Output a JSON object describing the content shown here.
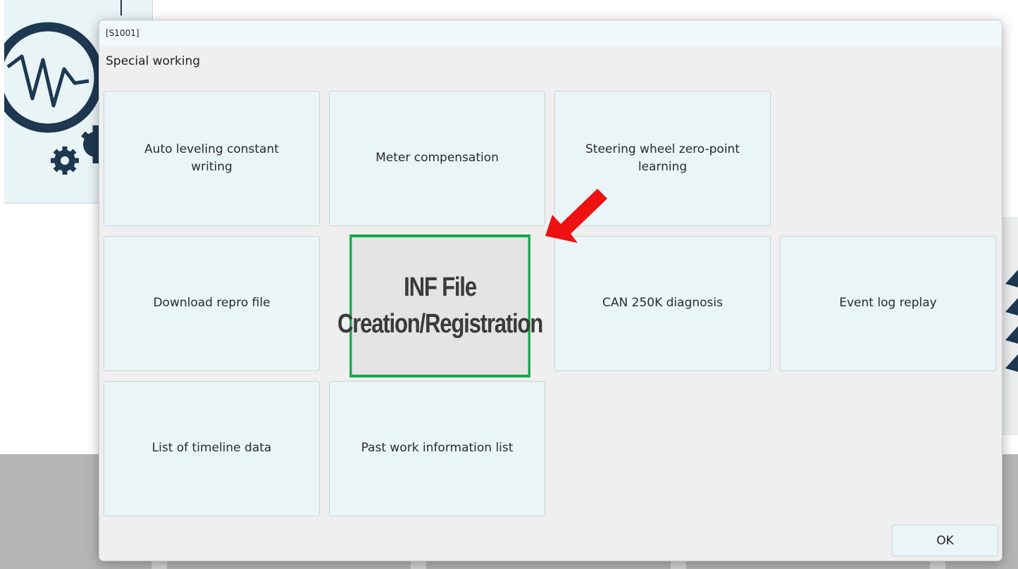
{
  "dialog": {
    "screen_id": "[S1001]",
    "title": "Special working",
    "ok_label": "OK"
  },
  "tiles": [
    {
      "label": "Auto leveling constant writing"
    },
    {
      "label": "Meter compensation"
    },
    {
      "label": "Steering wheel zero-point learning"
    },
    {
      "label": "Download repro file"
    },
    {
      "label": "INF File Creation/Registration"
    },
    {
      "label": "CAN 250K diagnosis"
    },
    {
      "label": "Event log replay"
    },
    {
      "label": "List of timeline data"
    },
    {
      "label": "Past work information list"
    }
  ],
  "annotation": {
    "arrow_color": "#ee1111",
    "highlight_color": "#13a84a",
    "arrow_icon": "red-arrow-icon"
  },
  "colors": {
    "tile_bg": "#eaf5f8",
    "dialog_bg": "#efefef",
    "logo_navy": "#1d3850"
  }
}
